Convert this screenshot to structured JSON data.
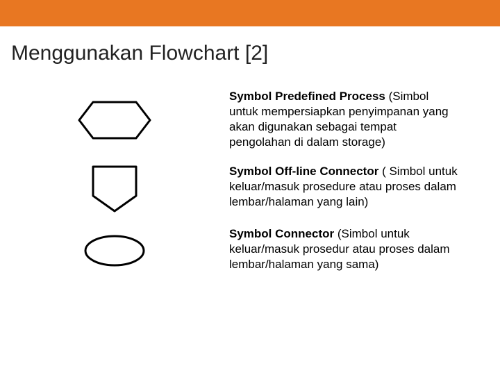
{
  "title": "Menggunakan Flowchart [2]",
  "symbols": [
    {
      "name": "Symbol Predefined Process",
      "desc": " (Simbol untuk mempersiapkan penyimpanan yang akan digunakan sebagai tempat pengolahan di dalam storage)"
    },
    {
      "name": "Symbol Off-line Connector",
      "desc": " ( Simbol untuk keluar/masuk prosedure atau proses dalam lembar/halaman yang lain)"
    },
    {
      "name": "Symbol Connector",
      "desc": " (Simbol untuk keluar/masuk prosedur atau proses dalam lembar/halaman yang sama)"
    }
  ]
}
